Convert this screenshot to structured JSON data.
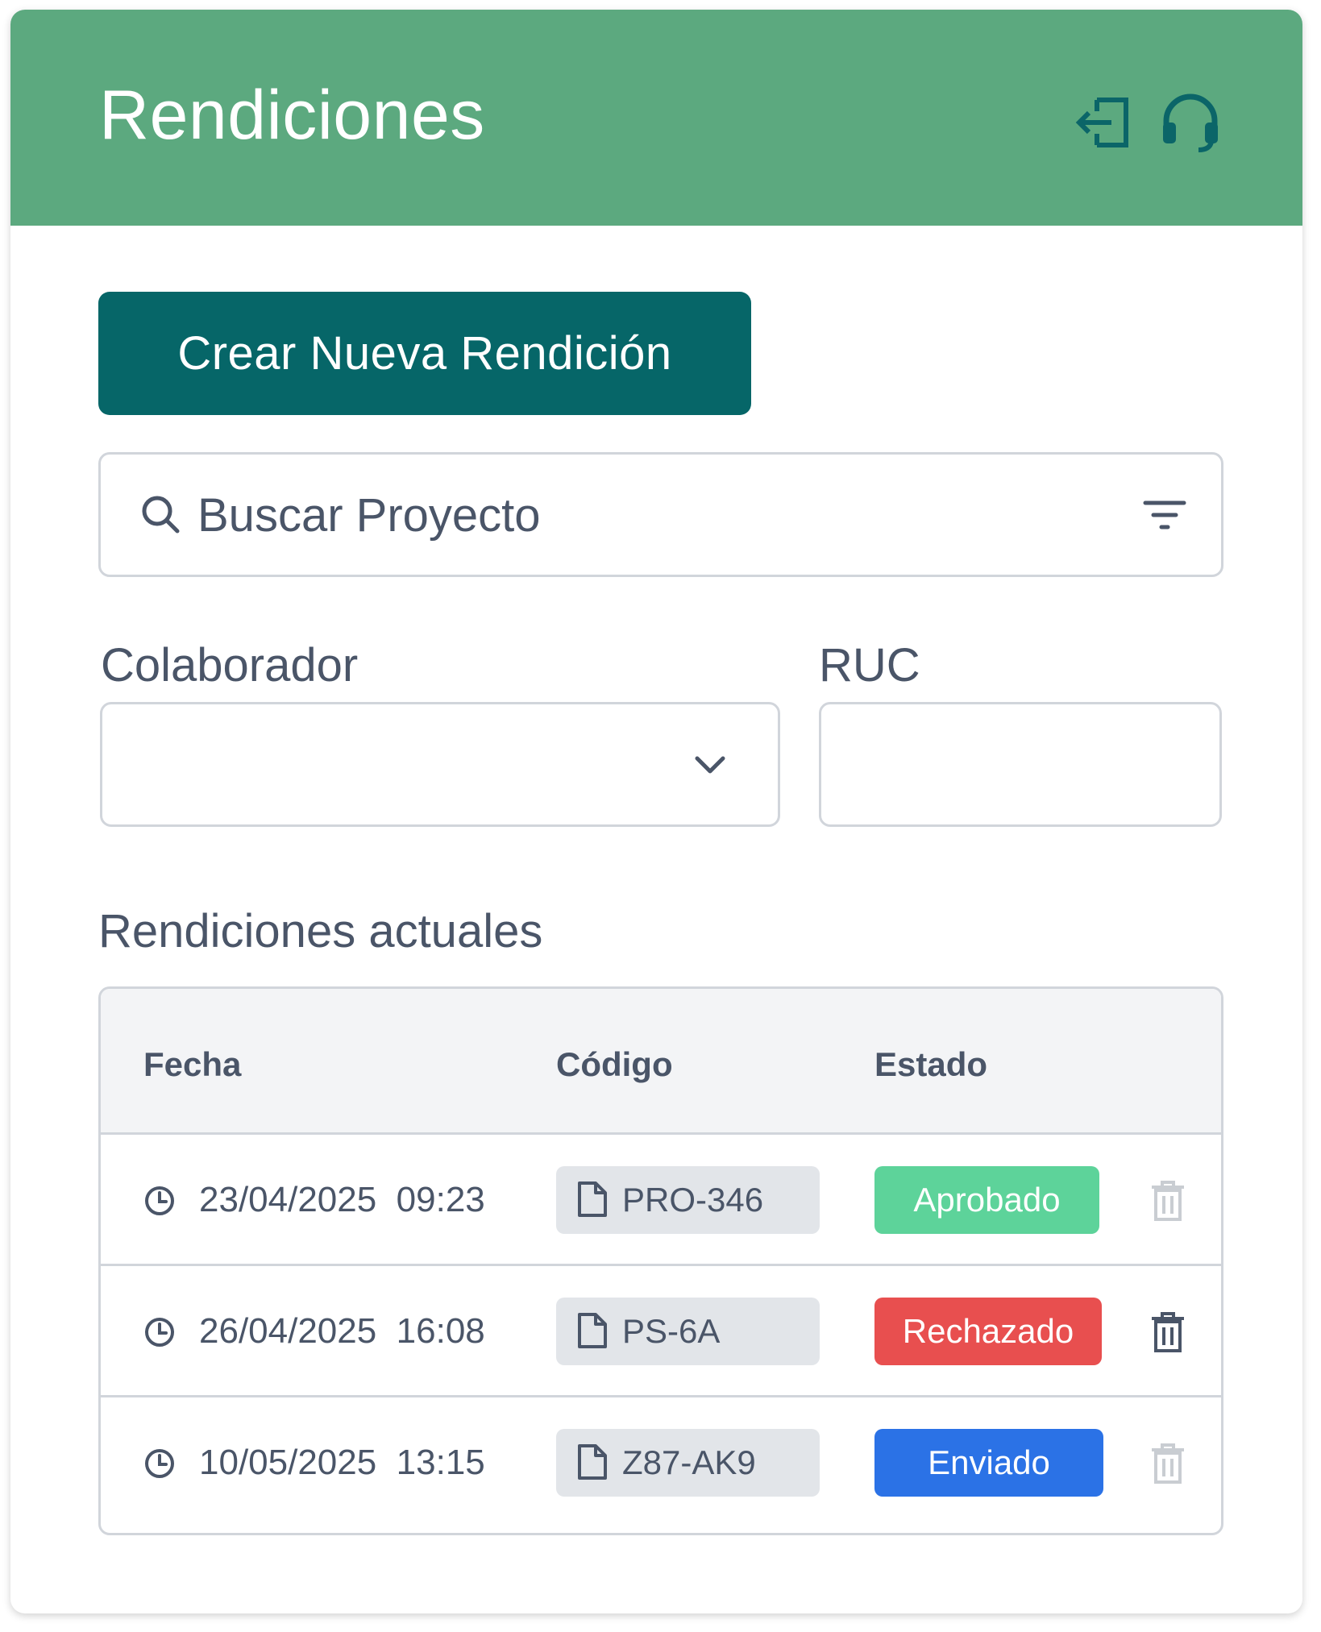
{
  "header": {
    "title": "Rendiciones",
    "icons": [
      "logout-icon",
      "headset-icon"
    ],
    "background_color": "#5ca97f",
    "icon_color": "#0b6568"
  },
  "actions": {
    "create_label": "Crear Nueva Rendición",
    "create_color": "#066668"
  },
  "search": {
    "placeholder": "Buscar Proyecto",
    "value": ""
  },
  "filters": {
    "colaborador_label": "Colaborador",
    "colaborador_value": "",
    "ruc_label": "RUC",
    "ruc_value": ""
  },
  "table": {
    "title": "Rendiciones actuales",
    "columns": [
      "Fecha",
      "Código",
      "Estado"
    ],
    "rows": [
      {
        "date": "23/04/2025",
        "time": "09:23",
        "code": "PRO-346",
        "status": "Aprobado",
        "status_color": "#5dd39a",
        "delete_enabled": false
      },
      {
        "date": "26/04/2025",
        "time": "16:08",
        "code": "PS-6A",
        "status": "Rechazado",
        "status_color": "#e84f4f",
        "delete_enabled": true
      },
      {
        "date": "10/05/2025",
        "time": "13:15",
        "code": "Z87-AK9",
        "status": "Enviado",
        "status_color": "#2b72e6",
        "delete_enabled": false
      }
    ]
  }
}
